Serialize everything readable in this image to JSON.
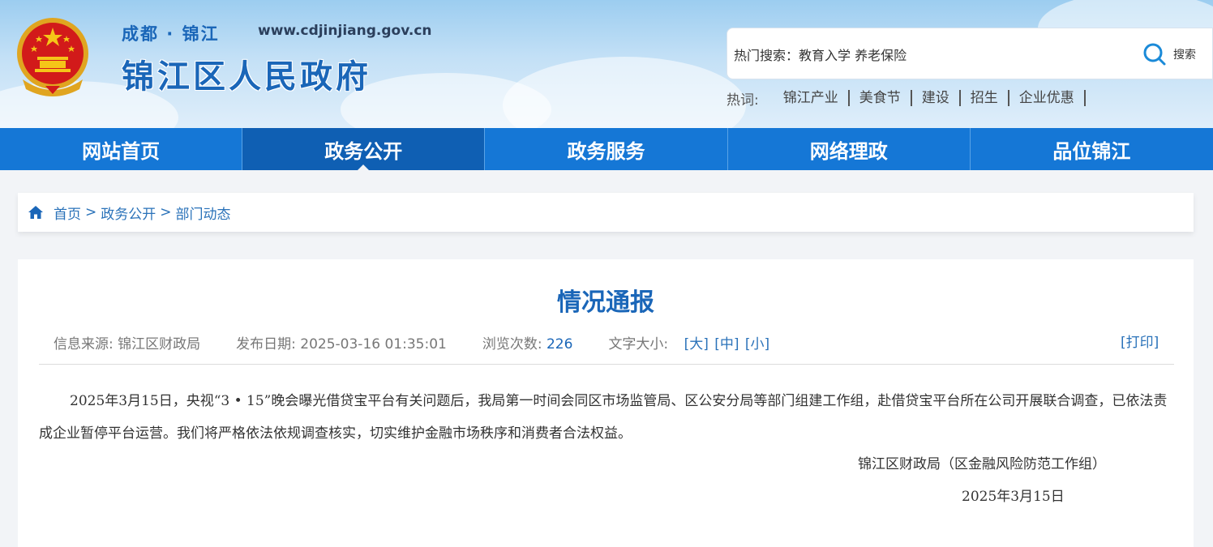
{
  "header": {
    "site_sub": "成都 · 锦江",
    "site_url": "www.cdjinjiang.gov.cn",
    "site_title": "锦江区人民政府"
  },
  "search": {
    "value": "热门搜索：教育入学 养老保险",
    "button_label": "搜索",
    "icon": "search-icon"
  },
  "hot_words": {
    "label": "热词:",
    "items": [
      "锦江产业",
      "美食节",
      "建设",
      "招生",
      "企业优惠"
    ]
  },
  "nav": {
    "items": [
      "网站首页",
      "政务公开",
      "政务服务",
      "网络理政",
      "品位锦江"
    ],
    "active": "政务公开"
  },
  "breadcrumb": {
    "icon": "home-icon",
    "items": [
      "首页",
      "政务公开",
      "部门动态"
    ],
    "separator": ">"
  },
  "article": {
    "title": "情况通报",
    "source_label": "信息来源:",
    "source": "锦江区财政局",
    "date_label": "发布日期:",
    "date": "2025-03-16 01:35:01",
    "views_label": "浏览次数:",
    "views": "226",
    "font_size_label": "文字大小:",
    "font_sizes": [
      "[大]",
      "[中]",
      "[小]"
    ],
    "print_label": "[打印]",
    "body": "2025年3月15日，央视“3 • 15”晚会曝光借贷宝平台有关问题后，我局第一时间会同区市场监管局、区公安分局等部门组建工作组，赴借贷宝平台所在公司开展联合调查，已依法责成企业暂停平台运营。我们将严格依法依规调查核实，切实维护金融市场秩序和消费者合法权益。",
    "sign_org": "锦江区财政局（区金融风险防范工作组）",
    "sign_date": "2025年3月15日"
  },
  "colors": {
    "nav_bg": "#1577d6",
    "nav_active": "#0f5fb3",
    "brand_blue": "#1a66b8",
    "link_blue": "#2a72b9"
  }
}
